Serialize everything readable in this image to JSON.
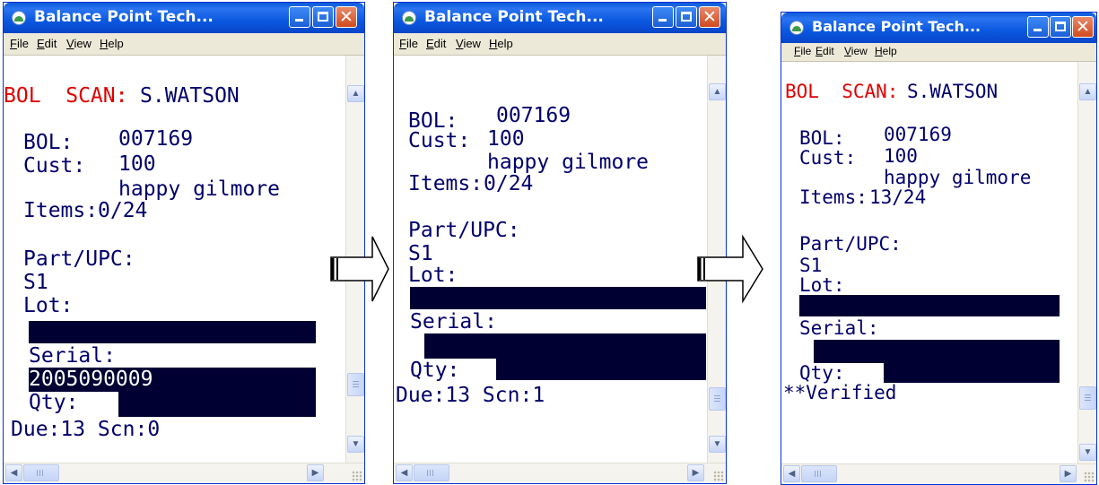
{
  "windows": [
    {
      "title": "Balance Point Tech...",
      "menu": [
        "File",
        "Edit",
        "View",
        "Help"
      ],
      "header_prefix": "BOL  SCAN:",
      "operator": "S.WATSON",
      "bol_label": "BOL:",
      "bol": "007169",
      "cust_label": "Cust:",
      "cust": "100",
      "customer_name": "happy gilmore",
      "items_label": "Items:",
      "items": "0/24",
      "part_label": "Part/UPC:",
      "part": "S1",
      "lot_label": "Lot:",
      "serial_label": "Serial:",
      "serial": "2005090009",
      "qty_label": "Qty:",
      "status": "Due:13 Scn:0"
    },
    {
      "title": "Balance Point Tech...",
      "menu": [
        "File",
        "Edit",
        "View",
        "Help"
      ],
      "bol_label": "BOL:",
      "bol": "007169",
      "cust_label": "Cust:",
      "cust": "100",
      "customer_name": "happy gilmore",
      "items_label": "Items:",
      "items": "0/24",
      "part_label": "Part/UPC:",
      "part": "S1",
      "lot_label": "Lot:",
      "serial_label": "Serial:",
      "qty_label": "Qty:",
      "status": "Due:13 Scn:1"
    },
    {
      "title": "Balance Point Tech...",
      "menu": [
        "File",
        "Edit",
        "View",
        "Help"
      ],
      "header_prefix": "BOL  SCAN:",
      "operator": "S.WATSON",
      "bol_label": "BOL:",
      "bol": "007169",
      "cust_label": "Cust:",
      "cust": "100",
      "customer_name": "happy gilmore",
      "items_label": "Items:",
      "items": "13/24",
      "part_label": "Part/UPC:",
      "part": "S1",
      "lot_label": "Lot:",
      "serial_label": "Serial:",
      "qty_label": "Qty:",
      "status": "**Verified"
    }
  ],
  "icons": {
    "app": "balance-point-app-icon",
    "minimize": "minimize-icon",
    "maximize": "maximize-icon",
    "close": "close-icon",
    "flow_arrow": "right-arrow-icon"
  },
  "colors": {
    "title_bar": "#0a58e0",
    "header_red": "#e00000",
    "field_text": "#00006b",
    "input_fill": "#000033"
  }
}
